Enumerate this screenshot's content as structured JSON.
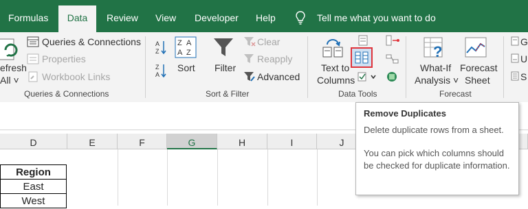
{
  "tabs": [
    "Formulas",
    "Data",
    "Review",
    "View",
    "Developer",
    "Help"
  ],
  "tell_me": "Tell me what you want to do",
  "ribbon": {
    "queries": {
      "refresh_label_1": "efresh",
      "refresh_label_2": "All ˅",
      "queries_connections": "Queries & Connections",
      "properties": "Properties",
      "workbook_links": "Workbook Links",
      "group_label": "Queries & Connections"
    },
    "sort_filter": {
      "sort": "Sort",
      "filter": "Filter",
      "clear": "Clear",
      "reapply": "Reapply",
      "advanced": "Advanced",
      "group_label": "Sort & Filter"
    },
    "data_tools": {
      "text_to_columns_1": "Text to",
      "text_to_columns_2": "Columns",
      "group_label": "Data Tools"
    },
    "forecast": {
      "whatif_1": "What-If",
      "whatif_2": "Analysis ˅",
      "forecast_sheet_1": "Forecast",
      "forecast_sheet_2": "Sheet",
      "group_label": "Forecast"
    },
    "outline_partial": [
      "G",
      "U",
      "S"
    ]
  },
  "columns": [
    "D",
    "E",
    "F",
    "G",
    "H",
    "I",
    "J"
  ],
  "cells": [
    "Region",
    "East",
    "West"
  ],
  "tooltip": {
    "title": "Remove Duplicates",
    "line1": "Delete duplicate rows from a sheet.",
    "line2": "You can pick which columns should be checked for duplicate information."
  },
  "colors": {
    "excel_green": "#217346",
    "highlight": "#e0333a"
  }
}
